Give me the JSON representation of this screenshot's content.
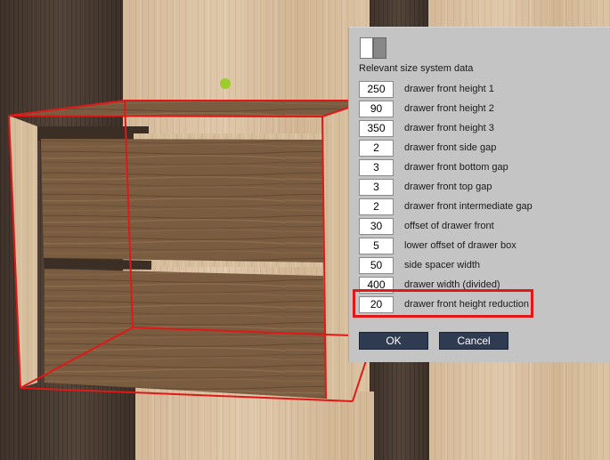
{
  "dialog": {
    "title": "Relevant size system data",
    "rows": [
      {
        "value": "250",
        "label": "drawer front height 1"
      },
      {
        "value": "90",
        "label": "drawer front height 2"
      },
      {
        "value": "350",
        "label": "drawer front height 3"
      },
      {
        "value": "2",
        "label": "drawer front side gap"
      },
      {
        "value": "3",
        "label": "drawer front bottom gap"
      },
      {
        "value": "3",
        "label": "drawer front top gap"
      },
      {
        "value": "2",
        "label": "drawer front intermediate gap"
      },
      {
        "value": "30",
        "label": "offset of drawer front"
      },
      {
        "value": "5",
        "label": "lower offset of drawer box"
      },
      {
        "value": "50",
        "label": "side spacer width"
      },
      {
        "value": "400",
        "label": "drawer width (divided)"
      },
      {
        "value": "20",
        "label": "drawer front height reduction"
      }
    ],
    "ok_label": "OK",
    "cancel_label": "Cancel"
  },
  "colors": {
    "highlight": "#e01818",
    "wireframe": "#e01818",
    "button_bg": "#2e3b51",
    "dialog_bg": "#c4c4c4",
    "marker": "#9ccc2a"
  },
  "icons": {
    "view_toggle": "two-tone-toggle-icon",
    "marker": "green-dot-icon"
  }
}
